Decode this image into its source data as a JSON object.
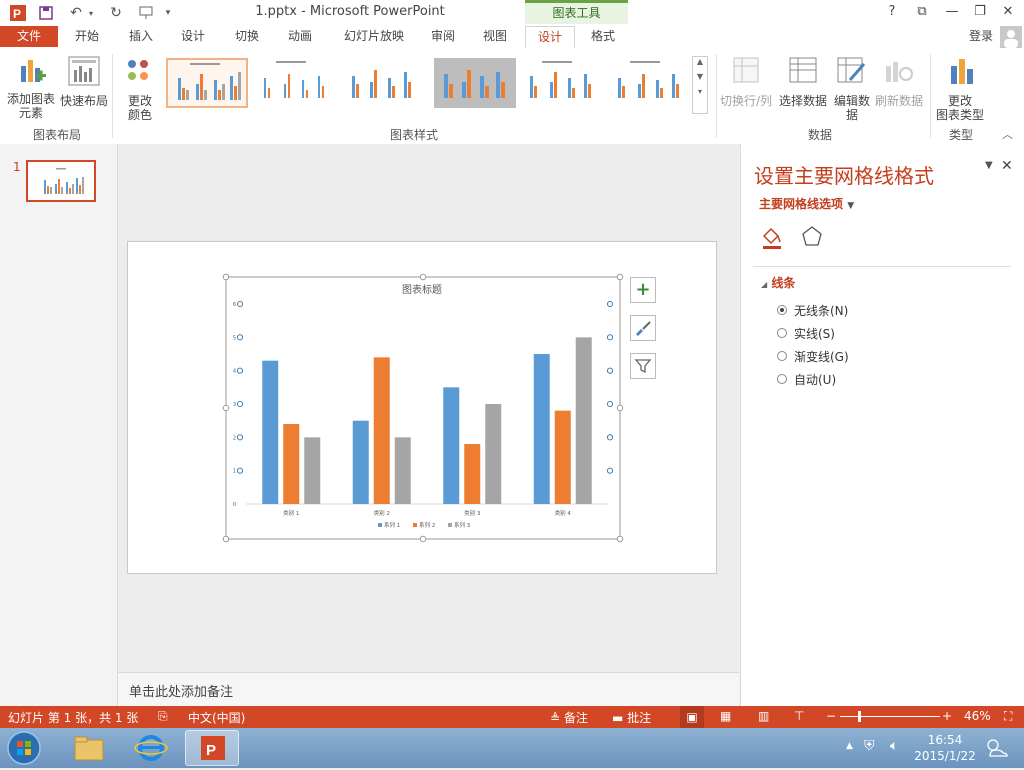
{
  "titlebar": {
    "title": "1.pptx - Microsoft PowerPoint",
    "context_tab": "图表工具",
    "help": "?",
    "login": "登录",
    "app_icon_letter": "P"
  },
  "tabs": [
    "文件",
    "开始",
    "插入",
    "设计",
    "切换",
    "动画",
    "幻灯片放映",
    "审阅",
    "视图",
    "设计",
    "格式"
  ],
  "ribbon": {
    "chart_layout": {
      "add_element": "添加图表\n元素",
      "quick_layout": "快速布局",
      "group": "图表布局"
    },
    "colors": {
      "label": "更改\n颜色"
    },
    "styles": {
      "group": "图表样式"
    },
    "data": {
      "switch": "切换行/列",
      "select": "选择数据",
      "edit": "编辑数\n据",
      "refresh": "刷新数据",
      "group": "数据"
    },
    "type": {
      "change": "更改\n图表类型",
      "group": "类型"
    }
  },
  "thumb": {
    "number": "1"
  },
  "chart_data": {
    "type": "bar",
    "title": "图表标题",
    "categories": [
      "类别 1",
      "类别 2",
      "类别 3",
      "类别 4"
    ],
    "series": [
      {
        "name": "系列 1",
        "values": [
          4.3,
          2.5,
          3.5,
          4.5
        ]
      },
      {
        "name": "系列 2",
        "values": [
          2.4,
          4.4,
          1.8,
          2.8
        ]
      },
      {
        "name": "系列 3",
        "values": [
          2.0,
          2.0,
          3.0,
          5.0
        ]
      }
    ],
    "ylim": [
      0,
      6
    ],
    "yticks": [
      "0",
      "1",
      "2",
      "3",
      "4",
      "5",
      "6"
    ],
    "legend": "bottom",
    "grid": false,
    "colors": [
      "#5b9bd5",
      "#ed7d31",
      "#a5a5a5"
    ]
  },
  "notes": {
    "placeholder": "单击此处添加备注"
  },
  "pane": {
    "title": "设置主要网格线格式",
    "subtitle": "主要网格线选项",
    "section": "线条",
    "options": [
      {
        "label": "无线条(N)",
        "selected": true
      },
      {
        "label": "实线(S)",
        "selected": false
      },
      {
        "label": "渐变线(G)",
        "selected": false
      },
      {
        "label": "自动(U)",
        "selected": false
      }
    ]
  },
  "status": {
    "slide": "幻灯片 第 1 张，共 1 张",
    "lang": "中文(中国)",
    "notes": "备注",
    "comments": "批注",
    "zoom": "46%"
  },
  "taskbar": {
    "time": "16:54",
    "date": "2015/1/22"
  },
  "accent": "#d24726"
}
